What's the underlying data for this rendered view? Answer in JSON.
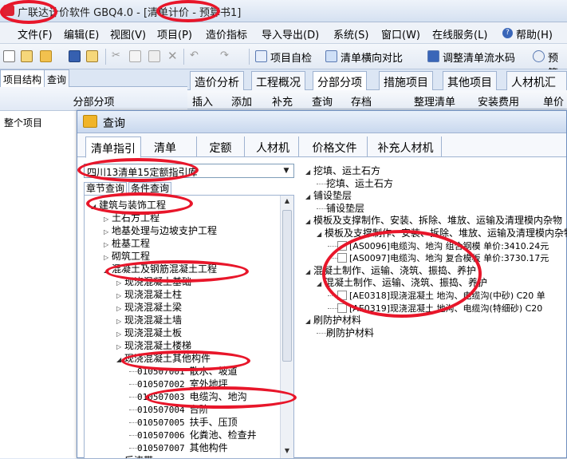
{
  "window": {
    "title": "广联达计价软件 GBQ4.0 - [清单计价 - 预算书1]"
  },
  "menu": [
    "文件(F)",
    "编辑(E)",
    "视图(V)",
    "项目(P)",
    "造价指标",
    "导入导出(D)",
    "系统(S)",
    "窗口(W)",
    "在线服务(L)",
    "帮助(H)"
  ],
  "toolbar": {
    "project_check": "项目自检",
    "horizontal_compare": "清单横向对比",
    "adjust_sequence": "调整清单流水码",
    "preview": "预算"
  },
  "left_tabs": [
    "项目结构",
    "查询"
  ],
  "left_header": "分部分项",
  "left_root": "整个项目",
  "doc_tabs": [
    "造价分析",
    "工程概况",
    "分部分项",
    "措施项目",
    "其他项目",
    "人材机汇总"
  ],
  "sub_toolbar": [
    "插入",
    "添加",
    "补充",
    "查询",
    "存档",
    "整理清单",
    "安装费用",
    "单价"
  ],
  "dialog": {
    "title": "查询",
    "tabs": [
      "清单指引",
      "清单",
      "定额",
      "人材机",
      "价格文件",
      "补充人材机"
    ],
    "library": "四川13清单15定额指引库",
    "subtabs": [
      "章节查询",
      "条件查询"
    ],
    "tree": [
      {
        "label": "建筑与装饰工程",
        "level": 0,
        "state": "open"
      },
      {
        "label": "土石方工程",
        "level": 1,
        "state": "closed"
      },
      {
        "label": "地基处理与边坡支护工程",
        "level": 1,
        "state": "closed"
      },
      {
        "label": "桩基工程",
        "level": 1,
        "state": "closed"
      },
      {
        "label": "砌筑工程",
        "level": 1,
        "state": "closed"
      },
      {
        "label": "混凝土及钢筋混凝土工程",
        "level": 1,
        "state": "open"
      },
      {
        "label": "现浇混凝土基础",
        "level": 2,
        "state": "closed"
      },
      {
        "label": "现浇混凝土柱",
        "level": 2,
        "state": "closed"
      },
      {
        "label": "现浇混凝土梁",
        "level": 2,
        "state": "closed"
      },
      {
        "label": "现浇混凝土墙",
        "level": 2,
        "state": "closed"
      },
      {
        "label": "现浇混凝土板",
        "level": 2,
        "state": "closed"
      },
      {
        "label": "现浇混凝土楼梯",
        "level": 2,
        "state": "closed"
      },
      {
        "label": "现浇混凝土其他构件",
        "level": 2,
        "state": "open"
      },
      {
        "code": "010507001",
        "label": "散水、坡道",
        "level": 3
      },
      {
        "code": "010507002",
        "label": "室外地坪",
        "level": 3
      },
      {
        "code": "010507003",
        "label": "电缆沟、地沟",
        "level": 3
      },
      {
        "code": "010507004",
        "label": "台阶",
        "level": 3
      },
      {
        "code": "010507005",
        "label": "扶手、压顶",
        "level": 3
      },
      {
        "code": "010507006",
        "label": "化粪池、检查井",
        "level": 3
      },
      {
        "code": "010507007",
        "label": "其他构件",
        "level": 3
      },
      {
        "label": "后浇带",
        "level": 2,
        "state": "closed"
      }
    ],
    "right_tree": [
      {
        "label": "挖填、运土石方",
        "level": 0,
        "state": "open"
      },
      {
        "label": "挖填、运土石方",
        "level": 1
      },
      {
        "label": "铺设垫层",
        "level": 0,
        "state": "open"
      },
      {
        "label": "铺设垫层",
        "level": 1
      },
      {
        "label": "模板及支撑制作、安装、拆除、堆放、运输及清理模内杂物",
        "level": 0,
        "state": "open"
      },
      {
        "label": "模板及支撑制作、安装、拆除、堆放、运输及清理模内杂物",
        "level": 1,
        "state": "open"
      },
      {
        "label": "[AS0096]电缆沟、地沟 组合钢模 单价:3410.24元",
        "level": 2,
        "check": true
      },
      {
        "label": "[AS0097]电缆沟、地沟 复合模板 单价:3730.17元",
        "level": 2,
        "check": true
      },
      {
        "label": "混凝土制作、运输、浇筑、振捣、养护",
        "level": 0,
        "state": "open"
      },
      {
        "label": "混凝土制作、运输、浇筑、振捣、养护",
        "level": 1,
        "state": "open"
      },
      {
        "label": "[AE0318]现浇混凝土 地沟、电缆沟(中砂) C20 单",
        "level": 2,
        "check": true
      },
      {
        "label": "[AE0319]现浇混凝土 地沟、电缆沟(特细砂) C20",
        "level": 2,
        "check": true
      },
      {
        "label": "刷防护材料",
        "level": 0,
        "state": "open"
      },
      {
        "label": "刷防护材料",
        "level": 1
      }
    ]
  },
  "colors": {
    "annotation": "#e8162a",
    "accent": "#4a6fa5"
  }
}
